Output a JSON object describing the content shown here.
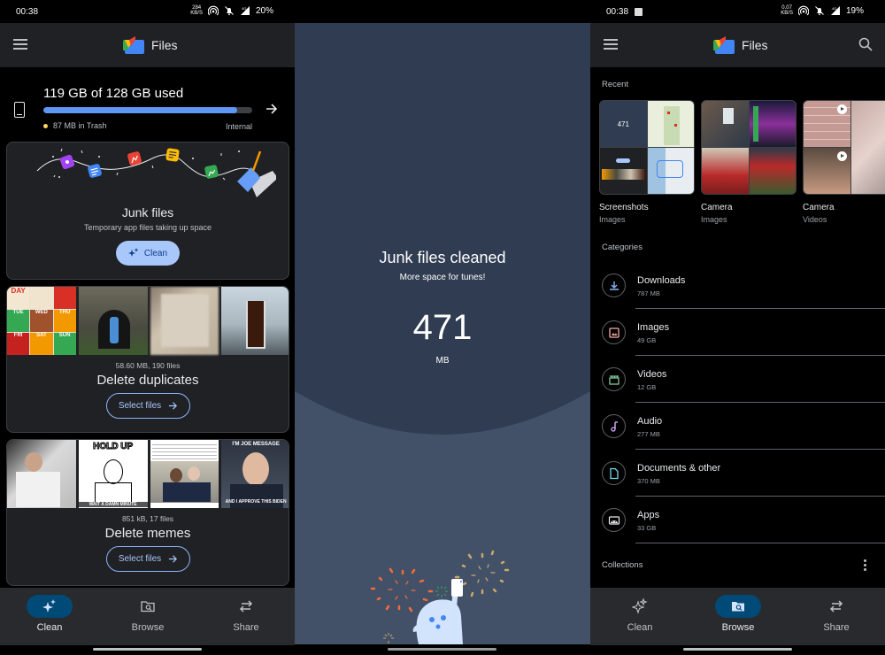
{
  "left": {
    "status": {
      "time": "00:38",
      "speed_top": "284",
      "speed_bottom": "KB/S",
      "network": "4G",
      "battery": "20%"
    },
    "appbar": {
      "title": "Files",
      "menu_icon": "menu-icon",
      "logo": "files-logo"
    },
    "storage": {
      "used_label": "119 GB of 128 GB used",
      "used_fraction": 0.93,
      "trash_label": "87 MB in Trash",
      "location": "Internal",
      "bar_color": "#5e97f6",
      "trash_dot_color": "#fdd663"
    },
    "junk_card": {
      "title": "Junk files",
      "subtitle": "Temporary app files taking up space",
      "button": "Clean"
    },
    "duplicates_card": {
      "meta": "58.60 MB, 190 files",
      "title": "Delete duplicates",
      "button": "Select files",
      "thumbnails": [
        "burger-menu-days",
        "person-in-cave",
        "blurred-id-card",
        "iced-drink-on-table"
      ],
      "menu_days": [
        "DAY",
        "TUE",
        "WED",
        "THU",
        "FRI",
        "SAT",
        "SUN"
      ]
    },
    "memes_card": {
      "meta": "851 kB, 17 files",
      "title": "Delete memes",
      "button": "Select files",
      "thumbnails": [
        "man-in-car",
        "hold-up-meme",
        "obama-biden-meme",
        "joe-message-meme"
      ],
      "meme_texts": [
        "HOLD UP",
        "WAIT A DAMN MINUTE",
        "I'M JOE MESSAGE",
        "AND I APPROVE THIS BIDEN"
      ]
    },
    "nav": [
      {
        "label": "Clean",
        "icon": "sparkle-icon",
        "active": true
      },
      {
        "label": "Browse",
        "icon": "folder-search-icon",
        "active": false
      },
      {
        "label": "Share",
        "icon": "swap-arrows-icon",
        "active": false
      }
    ]
  },
  "middle": {
    "title": "Junk files cleaned",
    "subtitle": "More space for tunes!",
    "amount": "471",
    "unit": "MB"
  },
  "right": {
    "status": {
      "time": "00:38",
      "speed_top": "0.07",
      "speed_bottom": "KB/S",
      "network": "4G",
      "battery": "19%"
    },
    "appbar": {
      "title": "Files"
    },
    "recent_label": "Recent",
    "recent": [
      {
        "name": "Screenshots",
        "type": "Images"
      },
      {
        "name": "Camera",
        "type": "Images"
      },
      {
        "name": "Camera",
        "type": "Videos"
      }
    ],
    "categories_label": "Categories",
    "categories": [
      {
        "name": "Downloads",
        "size": "787 MB",
        "icon": "download-icon",
        "color": "#8ab4f8"
      },
      {
        "name": "Images",
        "size": "49 GB",
        "icon": "image-icon",
        "color": "#f6aea9"
      },
      {
        "name": "Videos",
        "size": "12 GB",
        "icon": "clapperboard-icon",
        "color": "#81c995"
      },
      {
        "name": "Audio",
        "size": "277 MB",
        "icon": "music-note-icon",
        "color": "#d7aefb"
      },
      {
        "name": "Documents & other",
        "size": "370 MB",
        "icon": "document-icon",
        "color": "#78d9ec"
      },
      {
        "name": "Apps",
        "size": "33 GB",
        "icon": "android-icon",
        "color": "#e8eaed"
      }
    ],
    "collections_label": "Collections",
    "nav": [
      {
        "label": "Clean",
        "icon": "sparkle-icon",
        "active": false
      },
      {
        "label": "Browse",
        "icon": "folder-search-icon",
        "active": true
      },
      {
        "label": "Share",
        "icon": "swap-arrows-icon",
        "active": false
      }
    ]
  }
}
